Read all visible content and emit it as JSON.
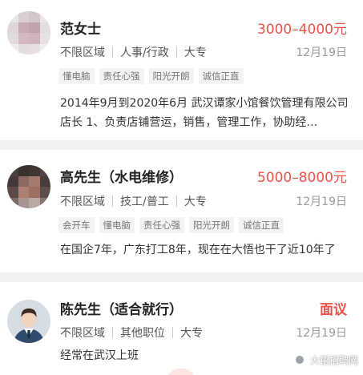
{
  "candidates": [
    {
      "name": "范女士",
      "salary": "3000–4000元",
      "area": "不限区域",
      "job": "人事/行政",
      "education": "大专",
      "date": "12月19日",
      "tags": [
        "懂电脑",
        "责任心强",
        "阳光开朗",
        "诚信正直"
      ],
      "description": "2014年9月到2020年6月 武汉谭家小馆餐饮管理有限公司 店长 1、负责店铺营运，销售，管理工作，协助经…"
    },
    {
      "name": "高先生（水电维修）",
      "salary": "5000–8000元",
      "area": "不限区域",
      "job": "技工/普工",
      "education": "大专",
      "date": "12月19日",
      "tags": [
        "会开车",
        "懂电脑",
        "责任心强",
        "阳光开朗",
        "诚信正直"
      ],
      "description": "在国企7年，广东打工8年，现在在大悟也干了近10年了"
    },
    {
      "name": "陈先生（适合就行）",
      "salary": "面议",
      "area": "不限区域",
      "job": "其他职位",
      "education": "大专",
      "date": "12月19日",
      "tags": [],
      "description": "经常在武汉上班"
    }
  ],
  "watermark": "大悟招聘网",
  "colors": {
    "salary": "#f0504a",
    "tag_bg": "#f3f3f3"
  }
}
